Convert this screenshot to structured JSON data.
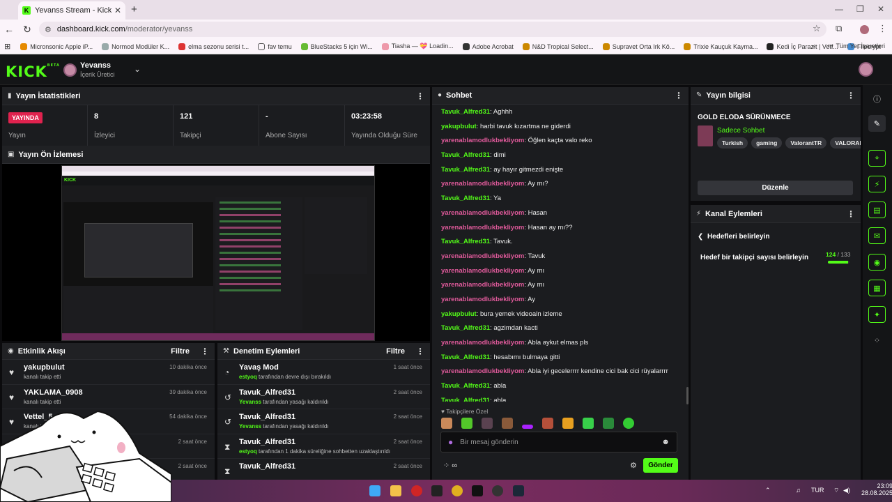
{
  "browser": {
    "tab_title": "Yevanss Stream - Kick Dashbo",
    "url_domain": "dashboard.kick.com",
    "url_path": "/moderator/yevanss",
    "bookmarks": [
      "Micronsonic Apple iP...",
      "Normod Modüler K...",
      "elma sezonu serisi t...",
      "fav temu",
      "BlueStacks 5 için Wi...",
      "Tiasha — 💝 Loadin...",
      "Adobe Acrobat",
      "N&D Tropical Select...",
      "Supravet Orta Irk Kö...",
      "Trixie Kauçuk Kayma...",
      "Kedi İç Parazit | Vetf...",
      "Filecrypt"
    ],
    "all_bookmarks": "Tüm Yer İşaretleri"
  },
  "header": {
    "logo": "KICK",
    "logo_badge": "BETA",
    "channel_name": "Yevanss",
    "channel_role": "İçerik Üretici"
  },
  "stats": {
    "title": "Yayın İstatistikleri",
    "items": [
      {
        "value": "YAYINDA",
        "label": "Yayın"
      },
      {
        "value": "8",
        "label": "İzleyici"
      },
      {
        "value": "121",
        "label": "Takipçi"
      },
      {
        "value": "-",
        "label": "Abone Sayısı"
      },
      {
        "value": "03:23:58",
        "label": "Yayında Olduğu Süre"
      }
    ]
  },
  "preview": {
    "title": "Yayın Ön İzlemesi"
  },
  "activity": {
    "title": "Etkinlik Akışı",
    "filter": "Filtre",
    "rows": [
      {
        "icon": "heart-icon",
        "name": "yakupbulut",
        "sub": "kanalı takip etti",
        "time": "10 dakika önce"
      },
      {
        "icon": "heart-icon",
        "name": "YAKLAMA_0908",
        "sub": "kanalı takip etti",
        "time": "39 dakika önce"
      },
      {
        "icon": "heart-icon",
        "name": "Vettel_5",
        "sub": "kanalı ta",
        "time": "54 dakika önce"
      },
      {
        "icon": "heart-icon",
        "name": "Ta",
        "sub": "",
        "time": "2 saat önce"
      },
      {
        "icon": "heart-icon",
        "name": "",
        "sub": "",
        "time": "2 saat önce"
      }
    ]
  },
  "mod": {
    "title": "Denetim Eylemleri",
    "filter": "Filtre",
    "rows": [
      {
        "icon": "slow-mode-icon",
        "name": "Yavaş Mod",
        "who": "estyoq",
        "sub": " tarafından devre dışı bırakıldı",
        "time": "1 saat önce"
      },
      {
        "icon": "undo-icon",
        "name": "Tavuk_Alfred31",
        "who": "Yevanss",
        "sub": " tarafından yasağı kaldırıldı",
        "time": "2 saat önce"
      },
      {
        "icon": "undo-icon",
        "name": "Tavuk_Alfred31",
        "who": "Yevanss",
        "sub": " tarafından yasağı kaldırıldı",
        "time": "2 saat önce"
      },
      {
        "icon": "hourglass-icon",
        "name": "Tavuk_Alfred31",
        "who": "estyoq",
        "sub": " tarafından 1 dakika süreliğine sohbetten uzaklaştırıldı",
        "time": "2 saat önce"
      },
      {
        "icon": "hourglass-icon",
        "name": "Tavuk_Alfred31",
        "who": "",
        "sub": "",
        "time": "2 saat önce"
      }
    ]
  },
  "chat": {
    "title": "Sohbet",
    "messages": [
      {
        "user": "Tavuk_Alfred31",
        "color": "#53fc18",
        "text": "Aghhh"
      },
      {
        "user": "yakupbulut",
        "color": "#53fc18",
        "text": "harbi tavuk kızartma ne giderdi"
      },
      {
        "user": "yarenablamodlukbekliyom",
        "color": "#e05a9b",
        "text": "Öğlen kaçta valo reko"
      },
      {
        "user": "Tavuk_Alfred31",
        "color": "#53fc18",
        "text": "dimi"
      },
      {
        "user": "Tavuk_Alfred31",
        "color": "#53fc18",
        "text": "ay hayır gitmezdi enişte"
      },
      {
        "user": "yarenablamodlukbekliyom",
        "color": "#e05a9b",
        "text": "Ay mı?"
      },
      {
        "user": "Tavuk_Alfred31",
        "color": "#53fc18",
        "text": "Ya"
      },
      {
        "user": "yarenablamodlukbekliyom",
        "color": "#e05a9b",
        "text": "Hasan"
      },
      {
        "user": "yarenablamodlukbekliyom",
        "color": "#e05a9b",
        "text": "Hasan ay mı??"
      },
      {
        "user": "Tavuk_Alfred31",
        "color": "#53fc18",
        "text": "Tavuk."
      },
      {
        "user": "yarenablamodlukbekliyom",
        "color": "#e05a9b",
        "text": "Tavuk"
      },
      {
        "user": "yarenablamodlukbekliyom",
        "color": "#e05a9b",
        "text": "Ay mı"
      },
      {
        "user": "yarenablamodlukbekliyom",
        "color": "#e05a9b",
        "text": "Ay mı"
      },
      {
        "user": "yarenablamodlukbekliyom",
        "color": "#e05a9b",
        "text": "Ay"
      },
      {
        "user": "yakupbulut",
        "color": "#53fc18",
        "text": "bura yemek videoaln izleme"
      },
      {
        "user": "Tavuk_Alfred31",
        "color": "#53fc18",
        "text": "agzimdan kacti"
      },
      {
        "user": "yarenablamodlukbekliyom",
        "color": "#e05a9b",
        "text": "Abla aykut elmas pls"
      },
      {
        "user": "Tavuk_Alfred31",
        "color": "#53fc18",
        "text": "hesabımı bulmaya gitti"
      },
      {
        "user": "yarenablamodlukbekliyom",
        "color": "#e05a9b",
        "text": "Abla iyi gecelerrrr kendine cici bak cici rüyalarrrr"
      },
      {
        "user": "Tavuk_Alfred31",
        "color": "#53fc18",
        "text": "abla"
      },
      {
        "user": "Tavuk_Alfred31",
        "color": "#53fc18",
        "text": "abla"
      }
    ],
    "emote_header": "Takipçilere Özel",
    "input_placeholder": "Bir mesaj gönderin",
    "send_label": "Gönder",
    "footer_symbol": "∞"
  },
  "info": {
    "title": "Yayın bilgisi",
    "stream_title": "GOLD ELODA SÜRÜNMECE",
    "category": "Sadece Sohbet",
    "tags": [
      "Turkish",
      "gaming",
      "ValorantTR",
      "VALORAN T"
    ],
    "edit_label": "Düzenle"
  },
  "actions": {
    "title": "Kanal Eylemleri",
    "back_label": "Hedefleri belirleyin",
    "goal_label": "Hedef bir takipçi sayısı belirleyin",
    "goal_current": "124",
    "goal_target": "/ 133",
    "goal_progress": 0.93
  },
  "taskbar": {
    "lang": "TUR",
    "time": "23:09",
    "date": "28.08.2025"
  },
  "colors": {
    "accent": "#53fc18",
    "live": "#e0224e",
    "pink_user": "#e05a9b"
  }
}
